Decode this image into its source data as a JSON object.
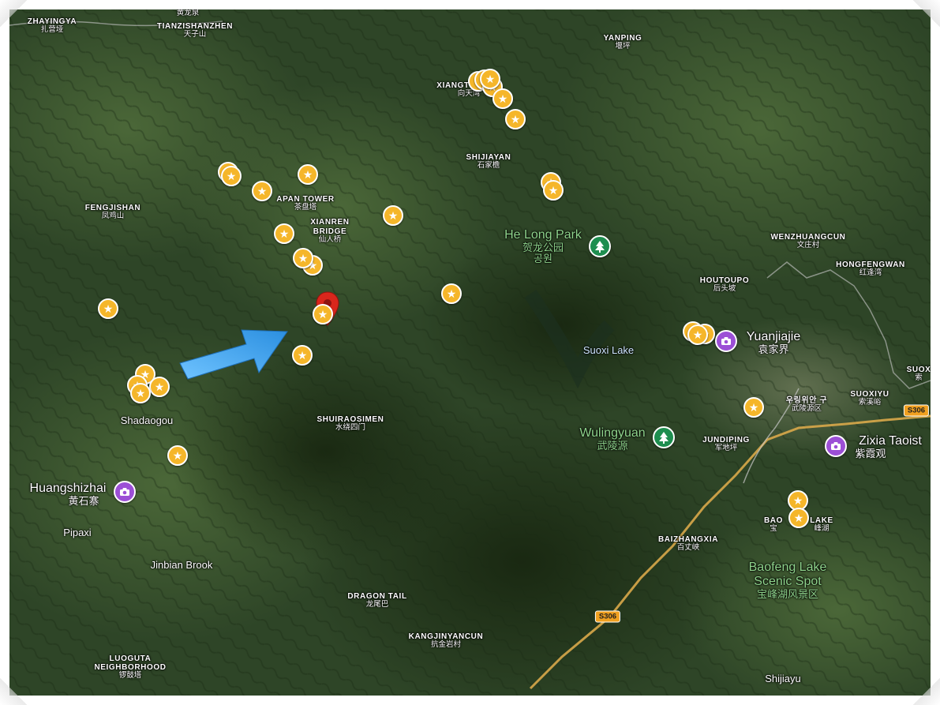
{
  "map": {
    "type": "satellite",
    "colors": {
      "terrain_dark": "#24361f",
      "terrain_mid": "#3b5630",
      "terrain_light": "#5e7048",
      "road": "#d9a94a",
      "star_marker": "#f5b62a",
      "camera_poi": "#9c4fd6",
      "park_poi": "#1e8e4f",
      "pin": "#d9261c",
      "arrow": "#3fa9f5"
    },
    "places": [
      {
        "en": "ZHAYINGYA",
        "zh": "扎营垭",
        "style": "town"
      },
      {
        "en": "",
        "zh": "黄龙泉",
        "style": "town"
      },
      {
        "en": "TIANZISHANZHEN",
        "zh": "天子山",
        "style": "town"
      },
      {
        "en": "YANPING",
        "zh": "堰坪",
        "style": "town"
      },
      {
        "en": "XIANGT",
        "zh": "向天湾",
        "style": "town"
      },
      {
        "en": "SHIJIAYAN",
        "zh": "石家檐",
        "style": "town"
      },
      {
        "en": "FENGJISHAN",
        "zh": "凤鸡山",
        "style": "town"
      },
      {
        "en": "APAN TOWER",
        "zh": "茶盘塔",
        "style": "town"
      },
      {
        "en": "XIANREN",
        "zh": "",
        "style": "town"
      },
      {
        "en": "BRIDGE",
        "zh": "仙人桥",
        "style": "town"
      },
      {
        "en": "He Long Park",
        "zh": "贺龙公园",
        "zh2": "공원",
        "style": "green"
      },
      {
        "en": "WENZHUANGCUN",
        "zh": "文庄村",
        "style": "town"
      },
      {
        "en": "HONGFENGWAN",
        "zh": "红逢湾",
        "style": "town"
      },
      {
        "en": "HOUTOUPO",
        "zh": "后头坡",
        "style": "town"
      },
      {
        "en": "Yuanjiajie",
        "zh": "袁家界",
        "style": "big"
      },
      {
        "en": "Suoxi Lake",
        "zh": "",
        "style": "water"
      },
      {
        "en": "SUOX",
        "zh": "索",
        "style": "town"
      },
      {
        "en": "SUOXIYU",
        "zh": "索溪峪",
        "style": "town"
      },
      {
        "en": "우링위안 구",
        "zh": "武陵源区",
        "style": "town"
      },
      {
        "en": "Shadaogou",
        "zh": "",
        "style": "plain"
      },
      {
        "en": "SHUIRAOSIMEN",
        "zh": "水绕四门",
        "style": "town"
      },
      {
        "en": "Wulingyuan",
        "zh": "武陵源",
        "style": "green"
      },
      {
        "en": "JUNDIPING",
        "zh": "军地坪",
        "style": "town"
      },
      {
        "en": "Zixia Taoist",
        "zh": "紫霞观",
        "style": "big"
      },
      {
        "en": "Huangshizhai",
        "zh": "黄石寨",
        "style": "big"
      },
      {
        "en": "Pipaxi",
        "zh": "",
        "style": "plain"
      },
      {
        "en": "BAO",
        "zh": "宝",
        "style": "town"
      },
      {
        "en": "LAKE",
        "zh": "峰湖",
        "style": "town"
      },
      {
        "en": "BAIZHANGXIA",
        "zh": "百丈峡",
        "style": "town"
      },
      {
        "en": "Jinbian Brook",
        "zh": "",
        "style": "plain"
      },
      {
        "en": "Baofeng Lake",
        "zh": "Scenic Spot",
        "zh2": "宝峰湖风景区",
        "style": "green"
      },
      {
        "en": "DRAGON TAIL",
        "zh": "龙尾巴",
        "style": "town"
      },
      {
        "en": "KANGJINYANCUN",
        "zh": "抗金岩村",
        "style": "town"
      },
      {
        "en": "LUOGUTA",
        "zh": "NEIGHBORHOOD",
        "zh2": "锣鼓塔",
        "style": "town"
      },
      {
        "en": "Shijiayu",
        "zh": "",
        "style": "plain"
      }
    ],
    "road_shields": [
      "S306",
      "S306"
    ],
    "star_marker_count": 30,
    "icons": {
      "star": "star-icon",
      "camera": "camera-icon",
      "tree": "tree-icon",
      "pin": "location-pin-icon",
      "arrow": "arrow-icon"
    }
  }
}
